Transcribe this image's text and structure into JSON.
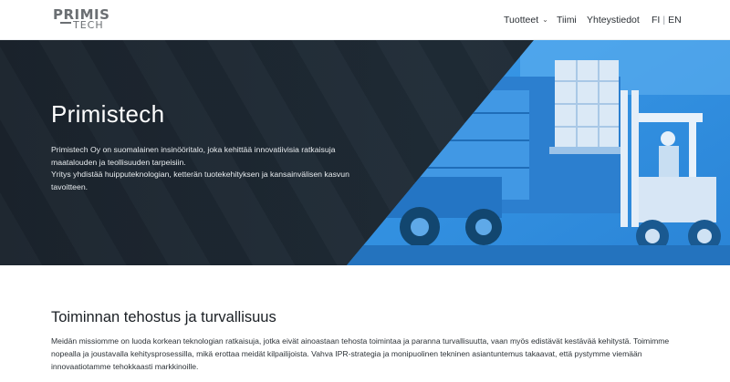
{
  "header": {
    "logo": {
      "line1": "PRIMIS",
      "line2": "TECH"
    },
    "nav": {
      "products": "Tuotteet",
      "team": "Tiimi",
      "contact": "Yhteystiedot",
      "lang_fi": "FI",
      "lang_sep": "|",
      "lang_en": "EN"
    }
  },
  "hero": {
    "title": "Primistech",
    "paragraph1": "Primistech Oy on suomalainen insinööritalo, joka kehittää innovatiivisia ratkaisuja maatalouden ja teollisuuden tarpeisiin.",
    "paragraph2": "Yritys yhdistää huipputeknologian, ketterän tuotekehityksen ja kansainvälisen kasvun tavoitteen.",
    "accent_color": "#2f8fe0"
  },
  "section": {
    "title": "Toiminnan tehostus ja turvallisuus",
    "text": "Meidän missiomme on luoda korkean teknologian ratkaisuja, jotka eivät ainoastaan tehosta toimintaa ja paranna turvallisuutta, vaan myös edistävät kestävää kehitystä. Toimimme nopealla ja joustavalla kehitysprosessilla, mikä erottaa meidät kilpailijoista. Vahva IPR-strategia ja monipuolinen tekninen asiantuntemus takaavat, että pystymme viemään innovaatiotamme tehokkaasti markkinoille."
  },
  "icons": {
    "products_dropdown": "chevron-down-icon"
  }
}
